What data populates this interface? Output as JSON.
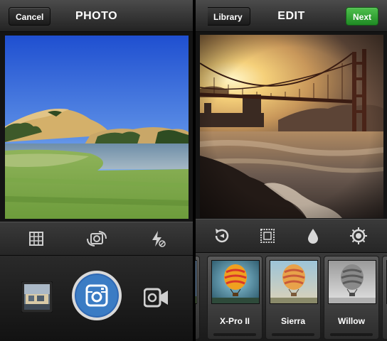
{
  "camera": {
    "title": "PHOTO",
    "cancel_label": "Cancel",
    "tools": [
      "grid-icon",
      "camera-switch-icon",
      "flash-off-icon"
    ],
    "bottom": [
      "gallery-thumbnail",
      "shutter-button",
      "video-mode-icon"
    ]
  },
  "edit": {
    "title": "EDIT",
    "back_label": "Library",
    "next_label": "Next",
    "tools": [
      "rotate-icon",
      "border-frame-icon",
      "tilt-shift-drop-icon",
      "lux-sun-icon"
    ],
    "filters": [
      {
        "label": "",
        "thumb": "balloon-normal"
      },
      {
        "label": "X-Pro II",
        "thumb": "balloon-xpro"
      },
      {
        "label": "Sierra",
        "thumb": "balloon-sierra"
      },
      {
        "label": "Willow",
        "thumb": "balloon-willow"
      }
    ]
  },
  "colors": {
    "next_button": "#2f9e2f",
    "shutter_ring": "#3b7cc4"
  }
}
